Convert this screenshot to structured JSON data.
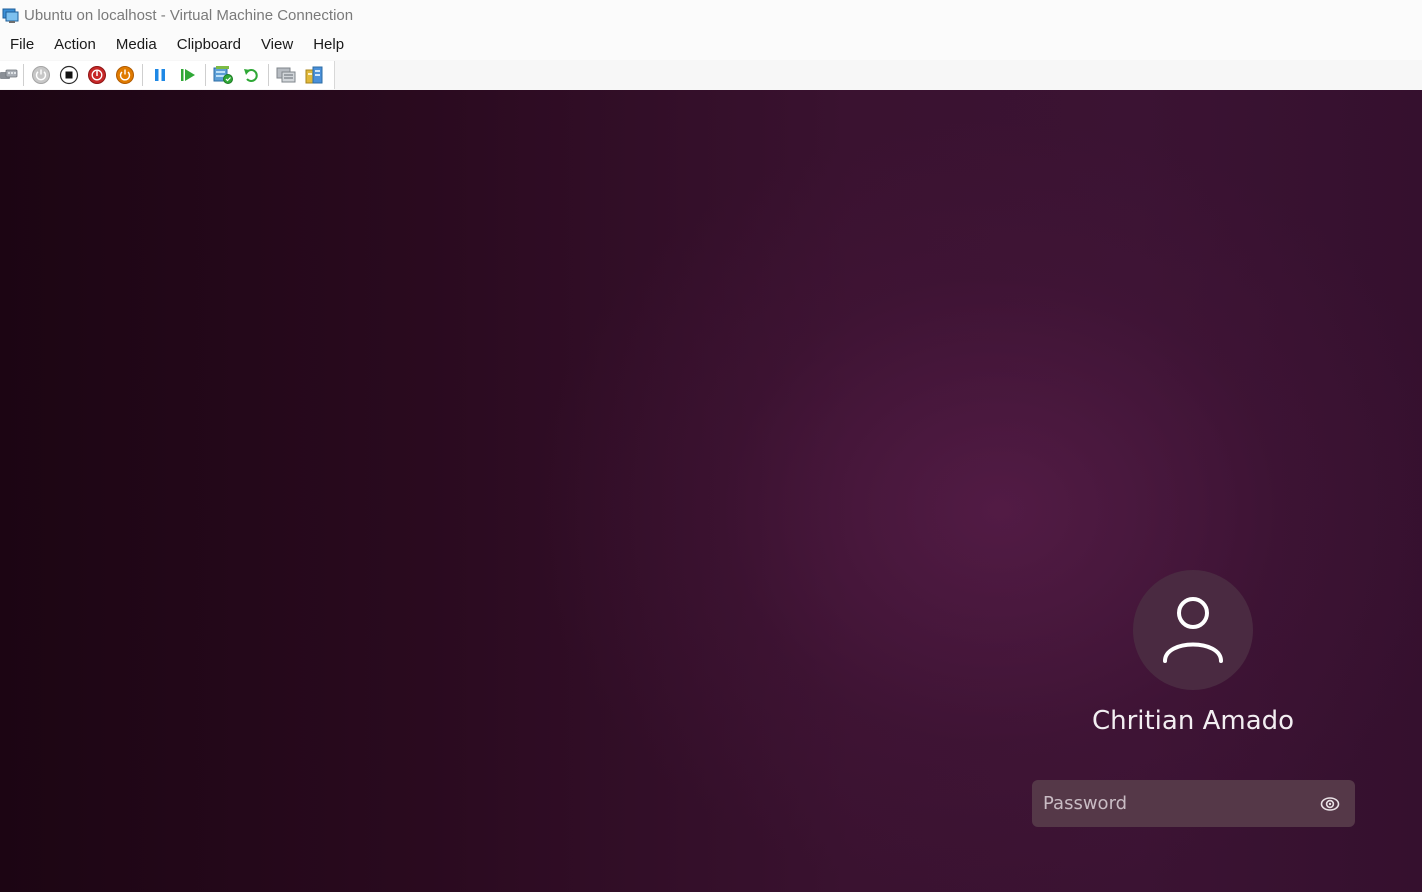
{
  "window": {
    "title": "Ubuntu on localhost - Virtual Machine Connection"
  },
  "menu": {
    "items": [
      "File",
      "Action",
      "Media",
      "Clipboard",
      "View",
      "Help"
    ]
  },
  "toolbar": {
    "buttons": [
      "ctrl-alt-del-icon",
      "start-icon",
      "turn-off-icon",
      "shutdown-icon",
      "save-state-icon",
      "pause-icon",
      "resume-icon",
      "checkpoint-icon",
      "revert-icon",
      "enhanced-session-icon",
      "share-icon"
    ]
  },
  "login": {
    "username": "Chritian Amado",
    "password_placeholder": "Password",
    "password_value": ""
  },
  "colors": {
    "accent_red": "#c62828",
    "accent_orange": "#e07b00",
    "accent_blue": "#1e88e5",
    "accent_green": "#2fa836"
  }
}
